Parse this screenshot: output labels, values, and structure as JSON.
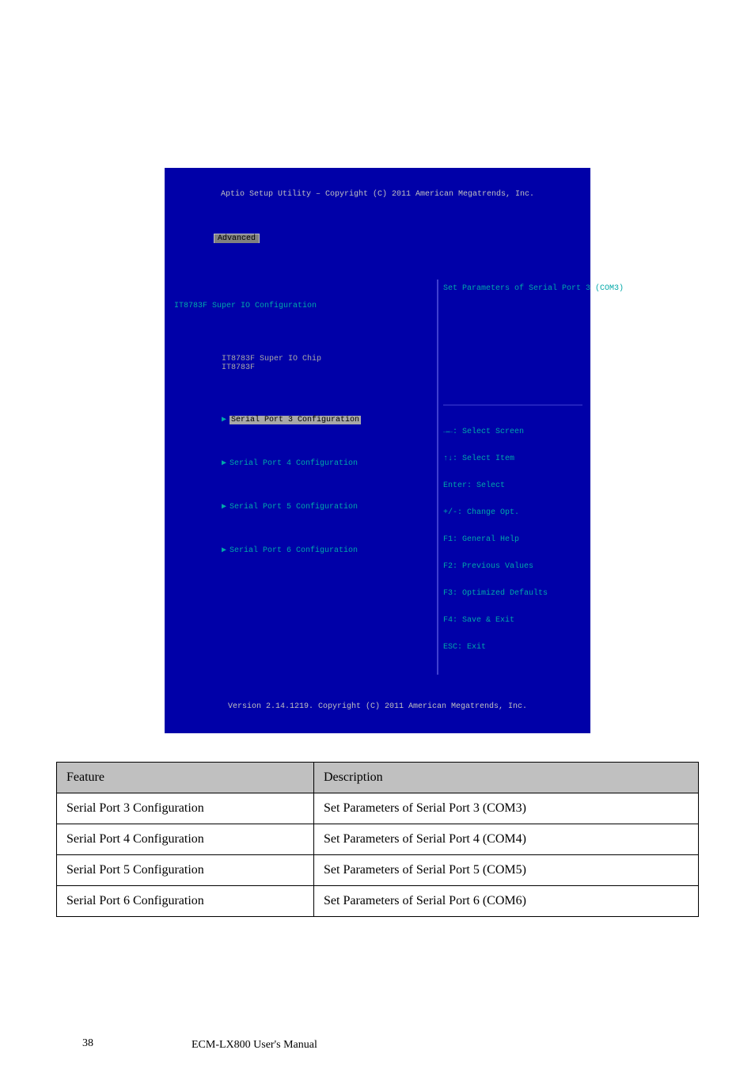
{
  "bios": {
    "title_top": "Aptio Setup Utility – Copyright (C) 2011 American Megatrends, Inc.",
    "active_tab": "Advanced",
    "heading": "IT8783F Super IO Configuration",
    "chip_label": "IT8783F Super IO Chip",
    "chip_value": "IT8783F",
    "menu": {
      "items": [
        {
          "label": "Serial Port 3 Configuration",
          "selected": true
        },
        {
          "label": "Serial Port 4 Configuration",
          "selected": false
        },
        {
          "label": "Serial Port 5 Configuration",
          "selected": false
        },
        {
          "label": "Serial Port 6 Configuration",
          "selected": false
        }
      ]
    },
    "help_context": "Set Parameters of Serial Port 3 (COM3)",
    "keys": [
      "→←: Select Screen",
      "↑↓: Select Item",
      "Enter: Select",
      "+/-: Change Opt.",
      "F1: General Help",
      "F2: Previous Values",
      "F3: Optimized Defaults",
      "F4: Save & Exit",
      "ESC: Exit"
    ],
    "footer": "Version 2.14.1219. Copyright (C) 2011 American Megatrends, Inc."
  },
  "table": {
    "headers": [
      "Feature",
      "Description"
    ],
    "rows": [
      {
        "feature": "Serial Port 3 Configuration",
        "desc": "Set Parameters of Serial Port 3 (COM3)"
      },
      {
        "feature": "Serial Port 4 Configuration",
        "desc": "Set Parameters of Serial Port 4 (COM4)"
      },
      {
        "feature": "Serial Port 5 Configuration",
        "desc": "Set Parameters of Serial Port 5 (COM5)"
      },
      {
        "feature": "Serial Port 6 Configuration",
        "desc": "Set Parameters of Serial Port 6 (COM6)"
      }
    ]
  },
  "page": {
    "number": "38",
    "footer": "ECM-LX800  User's Manual"
  }
}
